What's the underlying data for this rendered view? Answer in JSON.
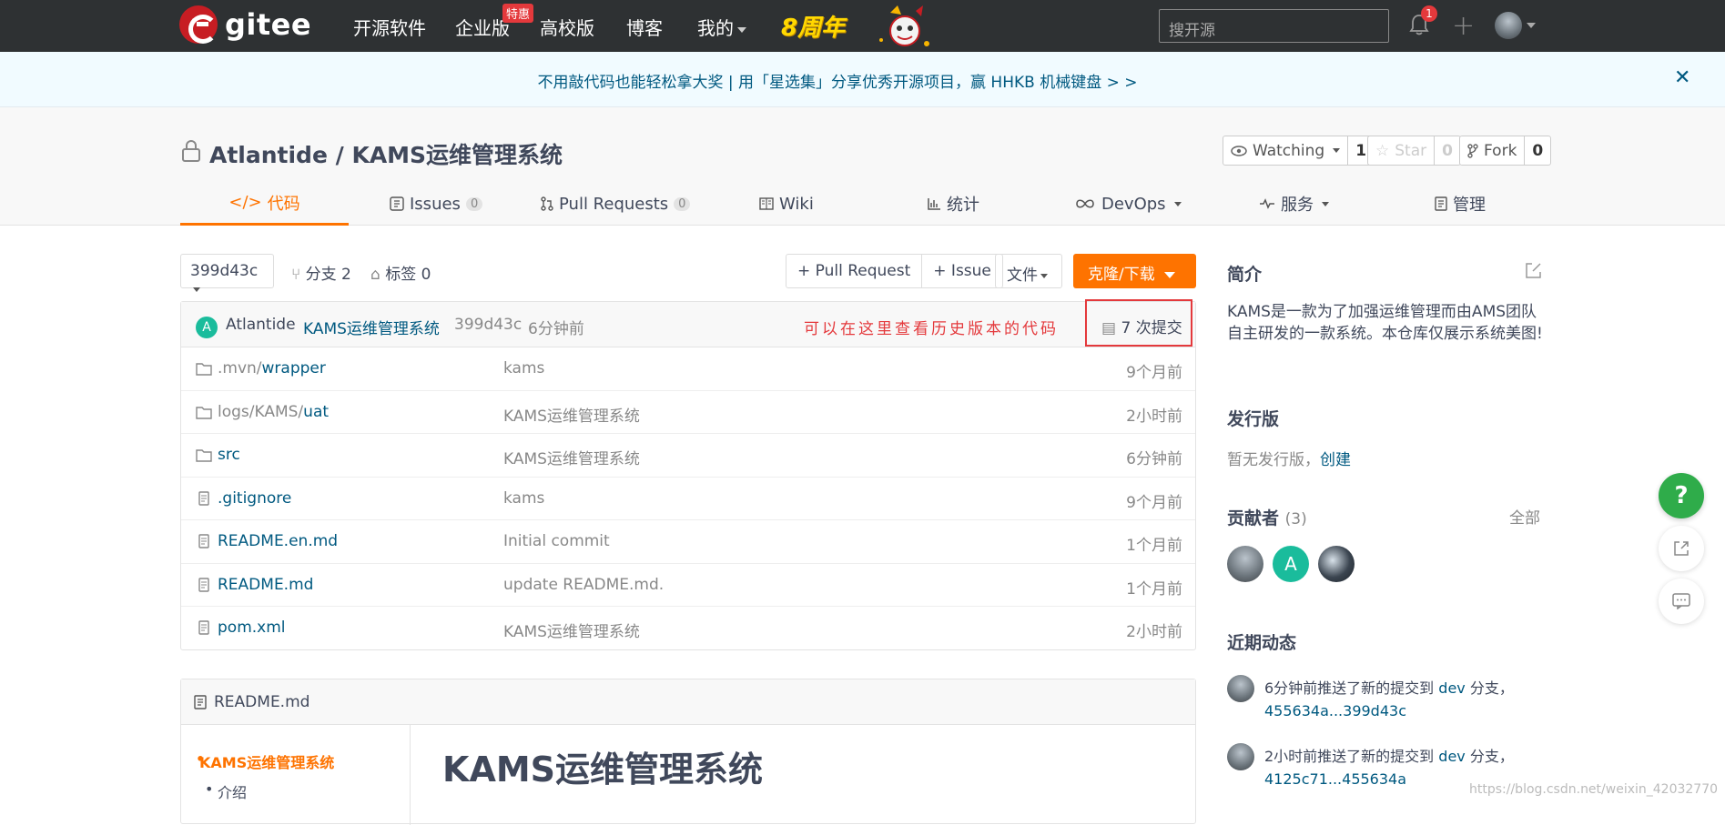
{
  "nav": {
    "brand": "gitee",
    "items": [
      "开源软件",
      "企业版",
      "高校版",
      "博客",
      "我的"
    ],
    "badge": "特惠",
    "anniversary": "8周年",
    "search_placeholder": "搜开源",
    "notifications": "1"
  },
  "banner": {
    "text": "不用敲代码也能轻松拿大奖 | 用「星选集」分享优秀开源项目，赢 HHKB 机械键盘 > >"
  },
  "repo": {
    "title": "Atlantide / KAMS运维管理系统",
    "watching_label": "Watching",
    "watching_count": "1",
    "star_label": "Star",
    "star_count": "0",
    "fork_label": "Fork",
    "fork_count": "0"
  },
  "tabs": [
    {
      "label": "代码"
    },
    {
      "label": "Issues",
      "count": "0"
    },
    {
      "label": "Pull Requests",
      "count": "0"
    },
    {
      "label": "Wiki"
    },
    {
      "label": "统计"
    },
    {
      "label": "DevOps"
    },
    {
      "label": "服务"
    },
    {
      "label": "管理"
    }
  ],
  "toolbar": {
    "branch": "399d43c",
    "branches": "分支 2",
    "tags": "标签 0",
    "pull_request": "+ Pull Request",
    "issue": "+ Issue",
    "file": "文件",
    "clone": "克隆/下载"
  },
  "commit": {
    "avatar_letter": "A",
    "author": "Atlantide",
    "message": "KAMS运维管理系统",
    "hash": "399d43c",
    "time": "6分钟前",
    "note": "可以在这里查看历史版本的代码",
    "commits": "7 次提交"
  },
  "files": [
    {
      "type": "folder",
      "dim": ".mvn/",
      "name": "wrapper",
      "commit": "kams",
      "time": "9个月前"
    },
    {
      "type": "folder",
      "dim": "logs/KAMS/",
      "name": "uat",
      "commit": "KAMS运维管理系统",
      "time": "2小时前"
    },
    {
      "type": "folder",
      "dim": "",
      "name": "src",
      "commit": "KAMS运维管理系统",
      "time": "6分钟前"
    },
    {
      "type": "file",
      "dim": "",
      "name": ".gitignore",
      "commit": "kams",
      "time": "9个月前"
    },
    {
      "type": "file",
      "dim": "",
      "name": "README.en.md",
      "commit": "Initial commit",
      "time": "1个月前"
    },
    {
      "type": "file",
      "dim": "",
      "name": "README.md",
      "commit": "update README.md.",
      "time": "1个月前"
    },
    {
      "type": "file",
      "dim": "",
      "name": "pom.xml",
      "commit": "KAMS运维管理系统",
      "time": "2小时前"
    }
  ],
  "readme": {
    "filename": "README.md",
    "toc": [
      "KAMS运维管理系统",
      "介绍"
    ],
    "heading": "KAMS运维管理系统"
  },
  "sidebar": {
    "intro_title": "简介",
    "intro_text": "KAMS是一款为了加强运维管理而由AMS团队自主研发的一款系统。本仓库仅展示系统美图!",
    "release_title": "发行版",
    "release_text": "暂无发行版，",
    "release_link": "创建",
    "contrib_title": "贡献者",
    "contrib_count": "(3)",
    "contrib_all": "全部",
    "contrib_letter": "A",
    "activity_title": "近期动态",
    "activities": [
      {
        "pre": "6分钟前推送了新的提交到 ",
        "branch": "dev",
        "mid": " 分支，",
        "range": "455634a...399d43c"
      },
      {
        "pre": "2小时前推送了新的提交到 ",
        "branch": "dev",
        "mid": " 分支，",
        "range": "4125c71...455634a"
      }
    ]
  },
  "watermark": "https://blog.csdn.net/weixin_42032770",
  "colors": {
    "accent": "#fe7300",
    "link": "#005980",
    "nav_bg": "#2e3133",
    "help": "#2fac4a",
    "annotation": "#e4393c"
  }
}
